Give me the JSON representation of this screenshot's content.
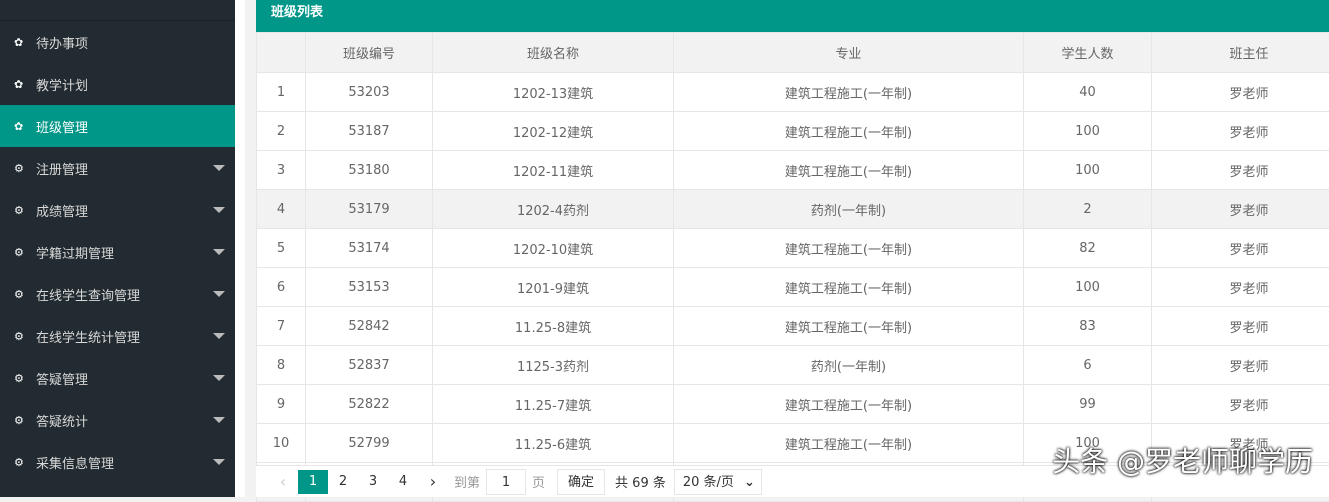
{
  "sidebar": {
    "items": [
      {
        "label": "待办事项",
        "icon": "gear-icon",
        "active": false,
        "expandable": false
      },
      {
        "label": "教学计划",
        "icon": "gear-icon",
        "active": false,
        "expandable": false
      },
      {
        "label": "班级管理",
        "icon": "gear-icon",
        "active": true,
        "expandable": false
      },
      {
        "label": "注册管理",
        "icon": "gears-icon",
        "active": false,
        "expandable": true
      },
      {
        "label": "成绩管理",
        "icon": "gears-icon",
        "active": false,
        "expandable": true
      },
      {
        "label": "学籍过期管理",
        "icon": "gears-icon",
        "active": false,
        "expandable": true
      },
      {
        "label": "在线学生查询管理",
        "icon": "gears-icon",
        "active": false,
        "expandable": true
      },
      {
        "label": "在线学生统计管理",
        "icon": "gears-icon",
        "active": false,
        "expandable": true
      },
      {
        "label": "答疑管理",
        "icon": "gears-icon",
        "active": false,
        "expandable": true
      },
      {
        "label": "答疑统计",
        "icon": "gears-icon",
        "active": false,
        "expandable": true
      },
      {
        "label": "采集信息管理",
        "icon": "gears-icon",
        "active": false,
        "expandable": true
      }
    ]
  },
  "main": {
    "title": "班级列表",
    "columns": [
      "",
      "班级编号",
      "班级名称",
      "专业",
      "学生人数",
      "班主任"
    ],
    "rows": [
      [
        "1",
        "53203",
        "1202-13建筑",
        "建筑工程施工(一年制)",
        "40",
        "罗老师"
      ],
      [
        "2",
        "53187",
        "1202-12建筑",
        "建筑工程施工(一年制)",
        "100",
        "罗老师"
      ],
      [
        "3",
        "53180",
        "1202-11建筑",
        "建筑工程施工(一年制)",
        "100",
        "罗老师"
      ],
      [
        "4",
        "53179",
        "1202-4药剂",
        "药剂(一年制)",
        "2",
        "罗老师"
      ],
      [
        "5",
        "53174",
        "1202-10建筑",
        "建筑工程施工(一年制)",
        "82",
        "罗老师"
      ],
      [
        "6",
        "53153",
        "1201-9建筑",
        "建筑工程施工(一年制)",
        "100",
        "罗老师"
      ],
      [
        "7",
        "52842",
        "11.25-8建筑",
        "建筑工程施工(一年制)",
        "83",
        "罗老师"
      ],
      [
        "8",
        "52837",
        "1125-3药剂",
        "药剂(一年制)",
        "6",
        "罗老师"
      ],
      [
        "9",
        "52822",
        "11.25-7建筑",
        "建筑工程施工(一年制)",
        "99",
        "罗老师"
      ],
      [
        "10",
        "52799",
        "11.25-6建筑",
        "建筑工程施工(一年制)",
        "100",
        "罗老师"
      ],
      [
        "",
        "",
        "",
        "",
        "",
        ""
      ]
    ],
    "highlighted_row": 3
  },
  "pager": {
    "prev": "‹",
    "pages": [
      "1",
      "2",
      "3",
      "4"
    ],
    "current": "1",
    "next": "›",
    "goto_label": "到第",
    "goto_value": "1",
    "page_label": "页",
    "confirm": "确定",
    "total": "共 69 条",
    "page_size": "20 条/页"
  },
  "watermark": "头条 @罗老师聊学历",
  "colors": {
    "accent": "#009688",
    "sidebar": "#222b31"
  }
}
